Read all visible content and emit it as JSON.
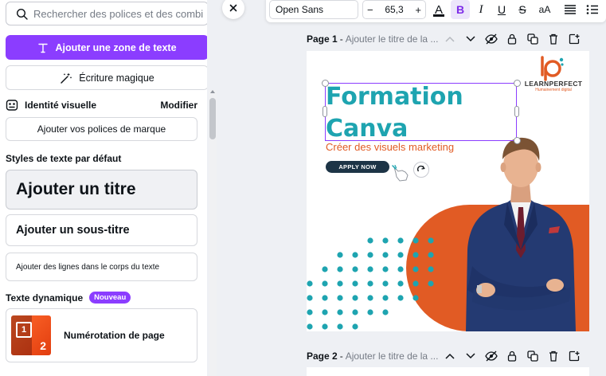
{
  "search": {
    "placeholder": "Rechercher des polices et des combi"
  },
  "panel": {
    "add_textbox_label": "Ajouter une zone de texte",
    "magic_write_label": "Écriture magique",
    "brand_kit_label": "Identité visuelle",
    "brand_kit_edit": "Modifier",
    "brand_fonts_label": "Ajouter vos polices de marque",
    "default_styles_heading": "Styles de texte par défaut",
    "title_style": "Ajouter un titre",
    "subtitle_style": "Ajouter un sous-titre",
    "body_style": "Ajouter des lignes dans le corps du texte",
    "dynamic_heading": "Texte dynamique",
    "new_badge": "Nouveau",
    "page_numbering_label": "Numérotation de page",
    "page_numbering_thumb_numbers": [
      "1",
      "2"
    ]
  },
  "toolbar": {
    "font_name": "Open Sans",
    "font_size": "65,3",
    "minus": "−",
    "plus": "+",
    "color_glyph": "A",
    "bold_glyph": "B",
    "italic_glyph": "I",
    "underline_glyph": "U",
    "strike_glyph": "S",
    "case_glyph": "aA"
  },
  "pages": [
    {
      "label": "Page 1",
      "title_placeholder": "Ajouter le titre de la ..."
    },
    {
      "label": "Page 2",
      "title_placeholder": "Ajouter le titre de la ..."
    }
  ],
  "design": {
    "heading_line1": "Formation",
    "heading_line2": "Canva",
    "subheading": "Créer des visuels marketing",
    "cta": "APPLY NOW",
    "logo_brand": "LEARNPERFECT",
    "logo_tagline": "Humainement digital"
  },
  "colors": {
    "accent_purple": "#8b3dff",
    "teal": "#1ea4b0",
    "orange": "#e15b24",
    "navy": "#1d3446"
  }
}
